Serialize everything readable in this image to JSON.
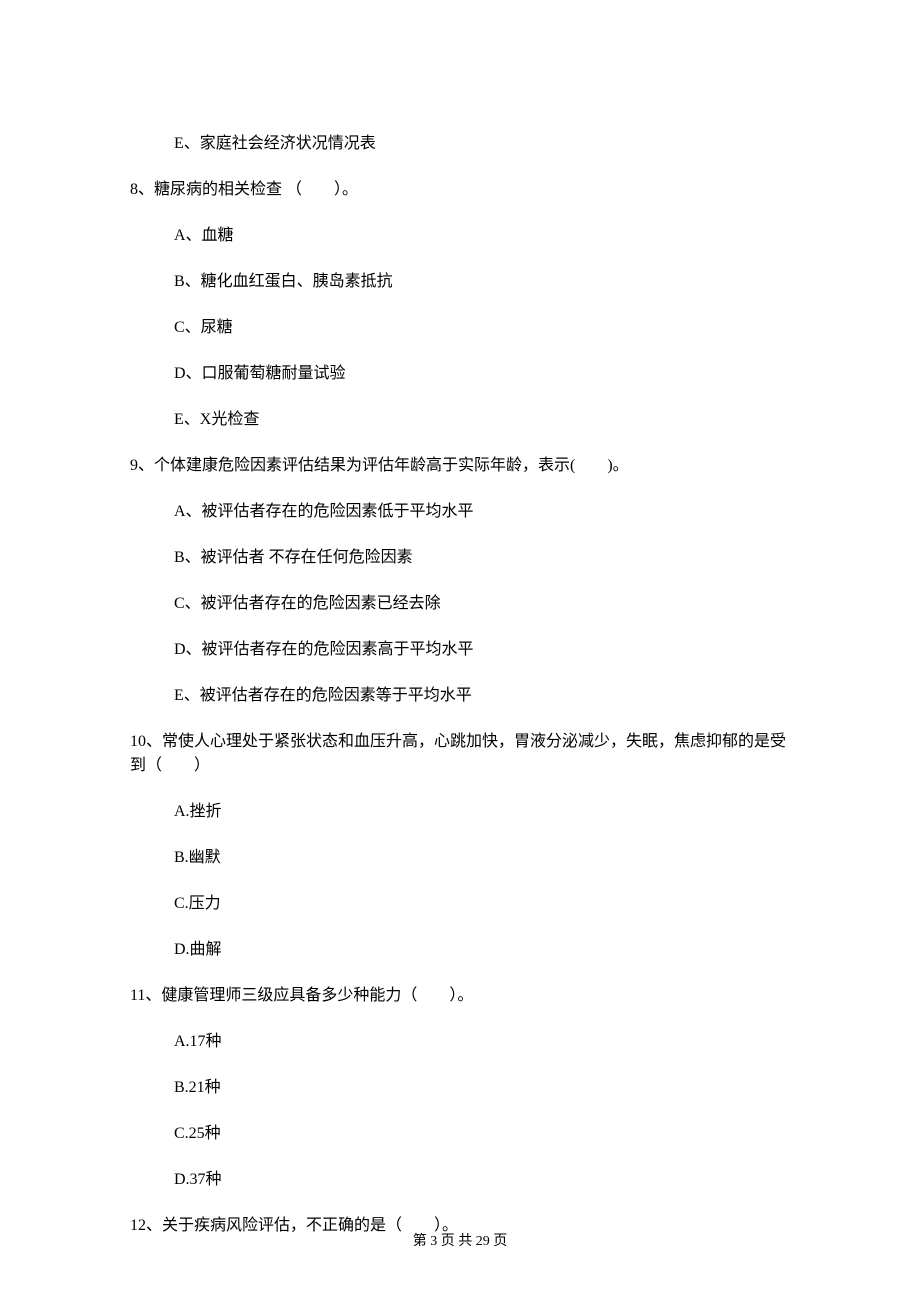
{
  "q7_optE": "E、家庭社会经济状况情况表",
  "q8_stem": "8、糖尿病的相关检查 （　　）。",
  "q8_A": "A、血糖",
  "q8_B": "B、糖化血红蛋白、胰岛素抵抗",
  "q8_C": "C、尿糖",
  "q8_D": "D、口服葡萄糖耐量试验",
  "q8_E": "E、X光检查",
  "q9_stem": "9、个体建康危险因素评估结果为评估年龄高于实际年龄，表示(　　)。",
  "q9_A": "A、被评估者存在的危险因素低于平均水平",
  "q9_B": "B、被评估者 不存在任何危险因素",
  "q9_C": "C、被评估者存在的危险因素已经去除",
  "q9_D": "D、被评估者存在的危险因素高于平均水平",
  "q9_E": "E、被评估者存在的危险因素等于平均水平",
  "q10_stem": "10、常使人心理处于紧张状态和血压升高，心跳加快，胃液分泌减少，失眠，焦虑抑郁的是受到（　　）",
  "q10_A": "A.挫折",
  "q10_B": "B.幽默",
  "q10_C": "C.压力",
  "q10_D": "D.曲解",
  "q11_stem": "11、健康管理师三级应具备多少种能力（　　）。",
  "q11_A": "A.17种",
  "q11_B": "B.21种",
  "q11_C": "C.25种",
  "q11_D": "D.37种",
  "q12_stem": "12、关于疾病风险评估，不正确的是（　　）。",
  "footer": "第 3 页 共 29 页"
}
